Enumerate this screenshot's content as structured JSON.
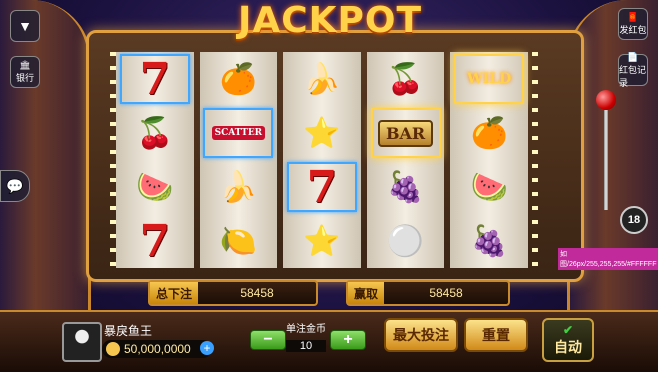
{
  "title": "JACKPOT",
  "reels": [
    [
      "7",
      "🍊",
      "🍒",
      "🍉",
      "7"
    ],
    [
      "🍊",
      "SCATTER",
      "🍌",
      "🍋"
    ],
    [
      "🍌",
      "⭐",
      "7",
      "⭐"
    ],
    [
      "🍒",
      "BAR",
      "🍇",
      "⚪"
    ],
    [
      "WILD",
      "🍊",
      "🍉",
      "🍇"
    ]
  ],
  "labels": {
    "total_bet": "总下注",
    "total_bet_value": "58458",
    "win": "赢取",
    "win_value": "58458",
    "player_name": "暴戾鱼王",
    "coins": "50,000,0000",
    "unit_bet": "单注金币",
    "unit_bet_value": "10",
    "max_bet": "最大投注",
    "reset": "重置",
    "auto": "自动",
    "bank": "银行",
    "send_red": "发红包",
    "red_record": "红包记录",
    "minus": "−",
    "plus": "+",
    "lever_number": "18",
    "debug_tag": "如图/26px/255,255,255/#FFFFFF"
  }
}
